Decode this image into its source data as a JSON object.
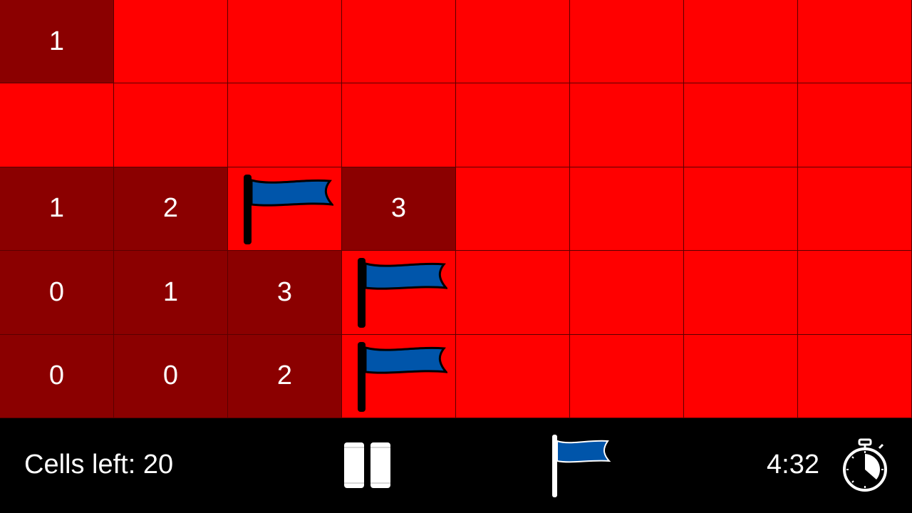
{
  "colors": {
    "hidden_cell": "#ff0000",
    "revealed_cell": "#8b0000",
    "flag_blue": "#0055aa",
    "bar_background": "#000000",
    "text": "#ffffff"
  },
  "board": {
    "rows": 5,
    "cols": 8,
    "cells": [
      [
        {
          "state": "revealed",
          "value": "1"
        },
        {
          "state": "hidden",
          "value": ""
        },
        {
          "state": "hidden",
          "value": ""
        },
        {
          "state": "hidden",
          "value": ""
        },
        {
          "state": "hidden",
          "value": ""
        },
        {
          "state": "hidden",
          "value": ""
        },
        {
          "state": "hidden",
          "value": ""
        },
        {
          "state": "hidden",
          "value": ""
        }
      ],
      [
        {
          "state": "hidden",
          "value": ""
        },
        {
          "state": "hidden",
          "value": ""
        },
        {
          "state": "hidden",
          "value": ""
        },
        {
          "state": "hidden",
          "value": ""
        },
        {
          "state": "hidden",
          "value": ""
        },
        {
          "state": "hidden",
          "value": ""
        },
        {
          "state": "hidden",
          "value": ""
        },
        {
          "state": "hidden",
          "value": ""
        }
      ],
      [
        {
          "state": "revealed",
          "value": "1"
        },
        {
          "state": "revealed",
          "value": "2"
        },
        {
          "state": "flag",
          "value": ""
        },
        {
          "state": "revealed",
          "value": "3"
        },
        {
          "state": "hidden",
          "value": ""
        },
        {
          "state": "hidden",
          "value": ""
        },
        {
          "state": "hidden",
          "value": ""
        },
        {
          "state": "hidden",
          "value": ""
        }
      ],
      [
        {
          "state": "revealed",
          "value": "0"
        },
        {
          "state": "revealed",
          "value": "1"
        },
        {
          "state": "revealed",
          "value": "3"
        },
        {
          "state": "flag",
          "value": ""
        },
        {
          "state": "hidden",
          "value": ""
        },
        {
          "state": "hidden",
          "value": ""
        },
        {
          "state": "hidden",
          "value": ""
        },
        {
          "state": "hidden",
          "value": ""
        }
      ],
      [
        {
          "state": "revealed",
          "value": "0"
        },
        {
          "state": "revealed",
          "value": "0"
        },
        {
          "state": "revealed",
          "value": "2"
        },
        {
          "state": "flag",
          "value": ""
        },
        {
          "state": "hidden",
          "value": ""
        },
        {
          "state": "hidden",
          "value": ""
        },
        {
          "state": "hidden",
          "value": ""
        },
        {
          "state": "hidden",
          "value": ""
        }
      ]
    ]
  },
  "status_bar": {
    "cells_left": "Cells left: 20",
    "pause_icon": "pause-icon",
    "flag_mode_icon": "flag-icon",
    "timer": "4:32",
    "timer_icon": "stopwatch-icon"
  }
}
